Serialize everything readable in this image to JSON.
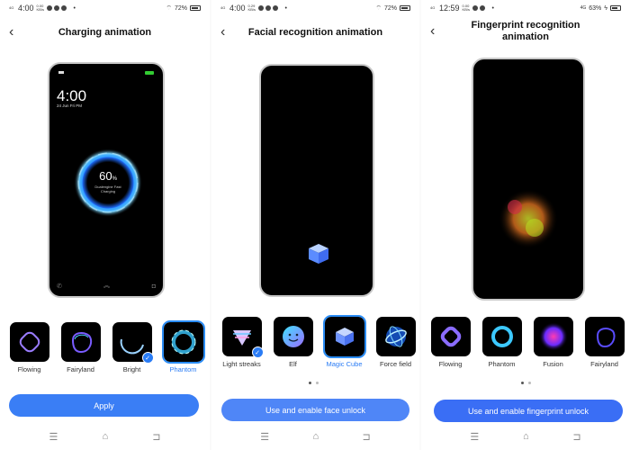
{
  "panels": [
    {
      "status": {
        "network": "4G",
        "time": "4:00",
        "speed": "0.00 KB/s",
        "battery": "72%",
        "battery_level": 0.72
      },
      "title": "Charging animation",
      "preview": {
        "time": "4:00",
        "date": "24 Jun Fri PM",
        "percent": "60",
        "percent_unit": "%",
        "caption": "Dualengine Fast Charging"
      },
      "options": [
        {
          "label": "Flowing",
          "icon": "flowing-ring-icon",
          "selected": false,
          "checked": false
        },
        {
          "label": "Fairyland",
          "icon": "fairyland-ring-icon",
          "selected": false,
          "checked": false
        },
        {
          "label": "Bright",
          "icon": "bright-ring-icon",
          "selected": false,
          "checked": true
        },
        {
          "label": "Phantom",
          "icon": "phantom-ring-icon",
          "selected": true,
          "checked": false
        }
      ],
      "button": "Apply"
    },
    {
      "status": {
        "network": "4G",
        "time": "4:00",
        "speed": "0.29 KB/s",
        "battery": "72%",
        "battery_level": 0.72
      },
      "title": "Facial recognition animation",
      "options": [
        {
          "label": "Light streaks",
          "icon": "light-streaks-icon",
          "selected": false,
          "checked": true
        },
        {
          "label": "Elf",
          "icon": "elf-face-icon",
          "selected": false,
          "checked": false
        },
        {
          "label": "Magic Cube",
          "icon": "magic-cube-icon",
          "selected": true,
          "checked": false
        },
        {
          "label": "Force field",
          "icon": "force-field-icon",
          "selected": false,
          "checked": false
        }
      ],
      "page_dots": 2,
      "page_active": 0,
      "button": "Use and enable face unlock"
    },
    {
      "status": {
        "network": "4G",
        "time": "12:59",
        "speed": "0.00 KB/s",
        "battery": "63%",
        "battery_level": 0.63,
        "charging": true
      },
      "title": "Fingerprint recognition animation",
      "options": [
        {
          "label": "Flowing",
          "icon": "flowing-icon",
          "selected": false,
          "checked": false
        },
        {
          "label": "Phantom",
          "icon": "phantom-icon",
          "selected": false,
          "checked": false
        },
        {
          "label": "Fusion",
          "icon": "fusion-icon",
          "selected": false,
          "checked": false
        },
        {
          "label": "Fairyland",
          "icon": "fairyland-icon",
          "selected": false,
          "checked": false
        }
      ],
      "page_dots": 2,
      "page_active": 0,
      "button": "Use and enable fingerprint unlock"
    }
  ],
  "nav": {
    "menu": "☰",
    "home": "⌂",
    "back": "⊐"
  },
  "colors": {
    "accent": "#3a7ef5",
    "selected_text": "#2a7cf5"
  }
}
